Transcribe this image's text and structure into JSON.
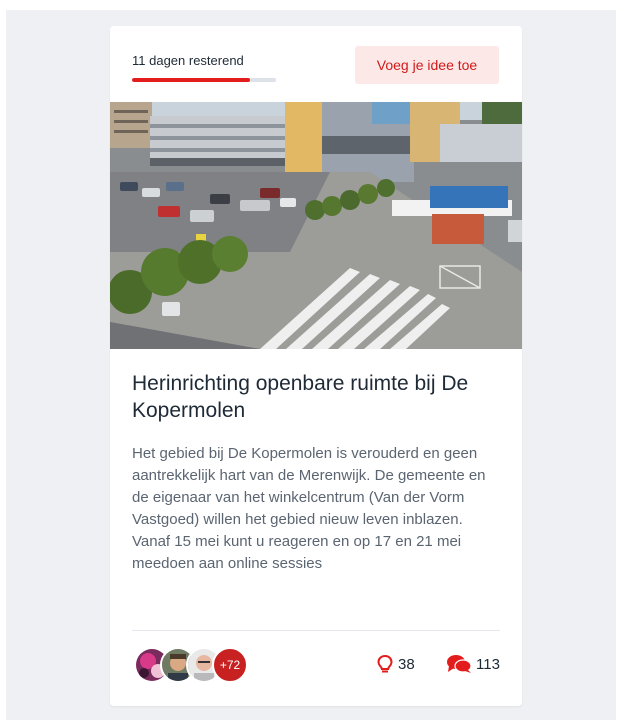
{
  "card": {
    "days_remaining": "11 dagen resterend",
    "progress": 0.82,
    "add_idea_label": "Voeg je idee toe",
    "title": "Herinrichting openbare ruimte bij De Kopermolen",
    "description": "Het gebied bij De Kopermolen is verouderd en geen aantrekkelijk hart van de Merenwijk. De gemeente en de eigenaar van het winkelcentrum (Van der Vorm Vastgoed) willen het gebied nieuw leven inblazen. Vanaf 15 mei kunt u reageren en op 17 en 21 mei meedoen aan online sessies",
    "participants_more": "+72",
    "ideas_count": "38",
    "comments_count": "113"
  },
  "colors": {
    "accent": "#e31c1c",
    "button_bg": "#fde8e8",
    "page_bg": "#eef0f3"
  },
  "icons": {
    "ideas": "lightbulb-icon",
    "comments": "chat-bubbles-icon"
  }
}
